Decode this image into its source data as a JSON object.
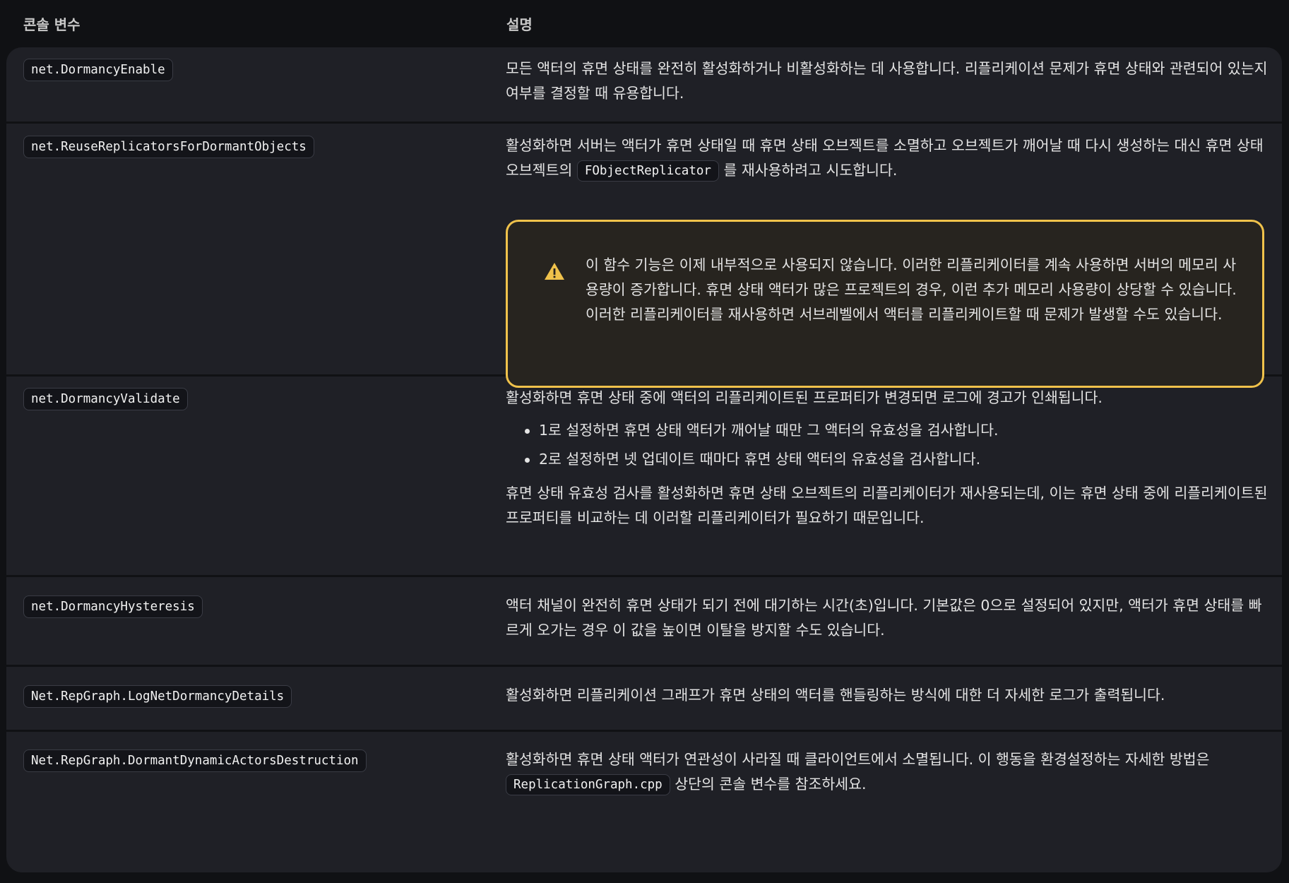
{
  "header": {
    "col_var": "콘솔 변수",
    "col_desc": "설명"
  },
  "rows": [
    {
      "var": "net.DormancyEnable",
      "desc": "모든 액터의 휴면 상태를 완전히 활성화하거나 비활성화하는 데 사용합니다. 리플리케이션 문제가 휴면 상태와 관련되어 있는지 여부를 결정할 때 유용합니다."
    },
    {
      "var": "net.ReuseReplicatorsForDormantObjects",
      "desc_before": "활성화하면 서버는 액터가 휴면 상태일 때 휴면 상태 오브젝트를 소멸하고 오브젝트가 깨어날 때 다시 생성하는 대신 휴면 상태 오브젝트의 ",
      "desc_code": "FObjectReplicator",
      "desc_after": " 를 재사용하려고 시도합니다.",
      "warning": "이 함수 기능은 이제 내부적으로 사용되지 않습니다. 이러한 리플리케이터를 계속 사용하면 서버의 메모리 사용량이 증가합니다. 휴면 상태 액터가 많은 프로젝트의 경우, 이런 추가 메모리 사용량이 상당할 수 있습니다. 이러한 리플리케이터를 재사용하면 서브레벨에서 액터를 리플리케이트할 때 문제가 발생할 수도 있습니다.",
      "warning_icon": "warning-triangle-icon"
    },
    {
      "var": "net.DormancyValidate",
      "desc_intro": "활성화하면 휴면 상태 중에 액터의 리플리케이트된 프로퍼티가 변경되면 로그에 경고가 인쇄됩니다.",
      "bullets": [
        "1로 설정하면 휴면 상태 액터가 깨어날 때만 그 액터의 유효성을 검사합니다.",
        "2로 설정하면 넷 업데이트 때마다 휴면 상태 액터의 유효성을 검사합니다."
      ],
      "desc_outro": "휴면 상태 유효성 검사를 활성화하면 휴면 상태 오브젝트의 리플리케이터가 재사용되는데, 이는 휴면 상태 중에 리플리케이트된 프로퍼티를 비교하는 데 이러할 리플리케이터가 필요하기 때문입니다."
    },
    {
      "var": "net.DormancyHysteresis",
      "desc": "액터 채널이 완전히 휴면 상태가 되기 전에 대기하는 시간(초)입니다. 기본값은 0으로 설정되어 있지만, 액터가 휴면 상태를 빠르게 오가는 경우 이 값을 높이면 이탈을 방지할 수도 있습니다."
    },
    {
      "var": "Net.RepGraph.LogNetDormancyDetails",
      "desc": "활성화하면 리플리케이션 그래프가 휴면 상태의 액터를 핸들링하는 방식에 대한 더 자세한 로그가 출력됩니다."
    },
    {
      "var": "Net.RepGraph.DormantDynamicActorsDestruction",
      "desc_before": "활성화하면 휴면 상태 액터가 연관성이 사라질 때 클라이언트에서 소멸됩니다. 이 행동을 환경설정하는 자세한 방법은 ",
      "desc_code": "ReplicationGraph.cpp",
      "desc_after": " 상단의 콘솔 변수를 참조하세요."
    }
  ],
  "colors": {
    "page_bg": "#101114",
    "table_bg": "#1f2026",
    "warning_border": "#f0c24b",
    "warning_bg": "#27241f"
  }
}
